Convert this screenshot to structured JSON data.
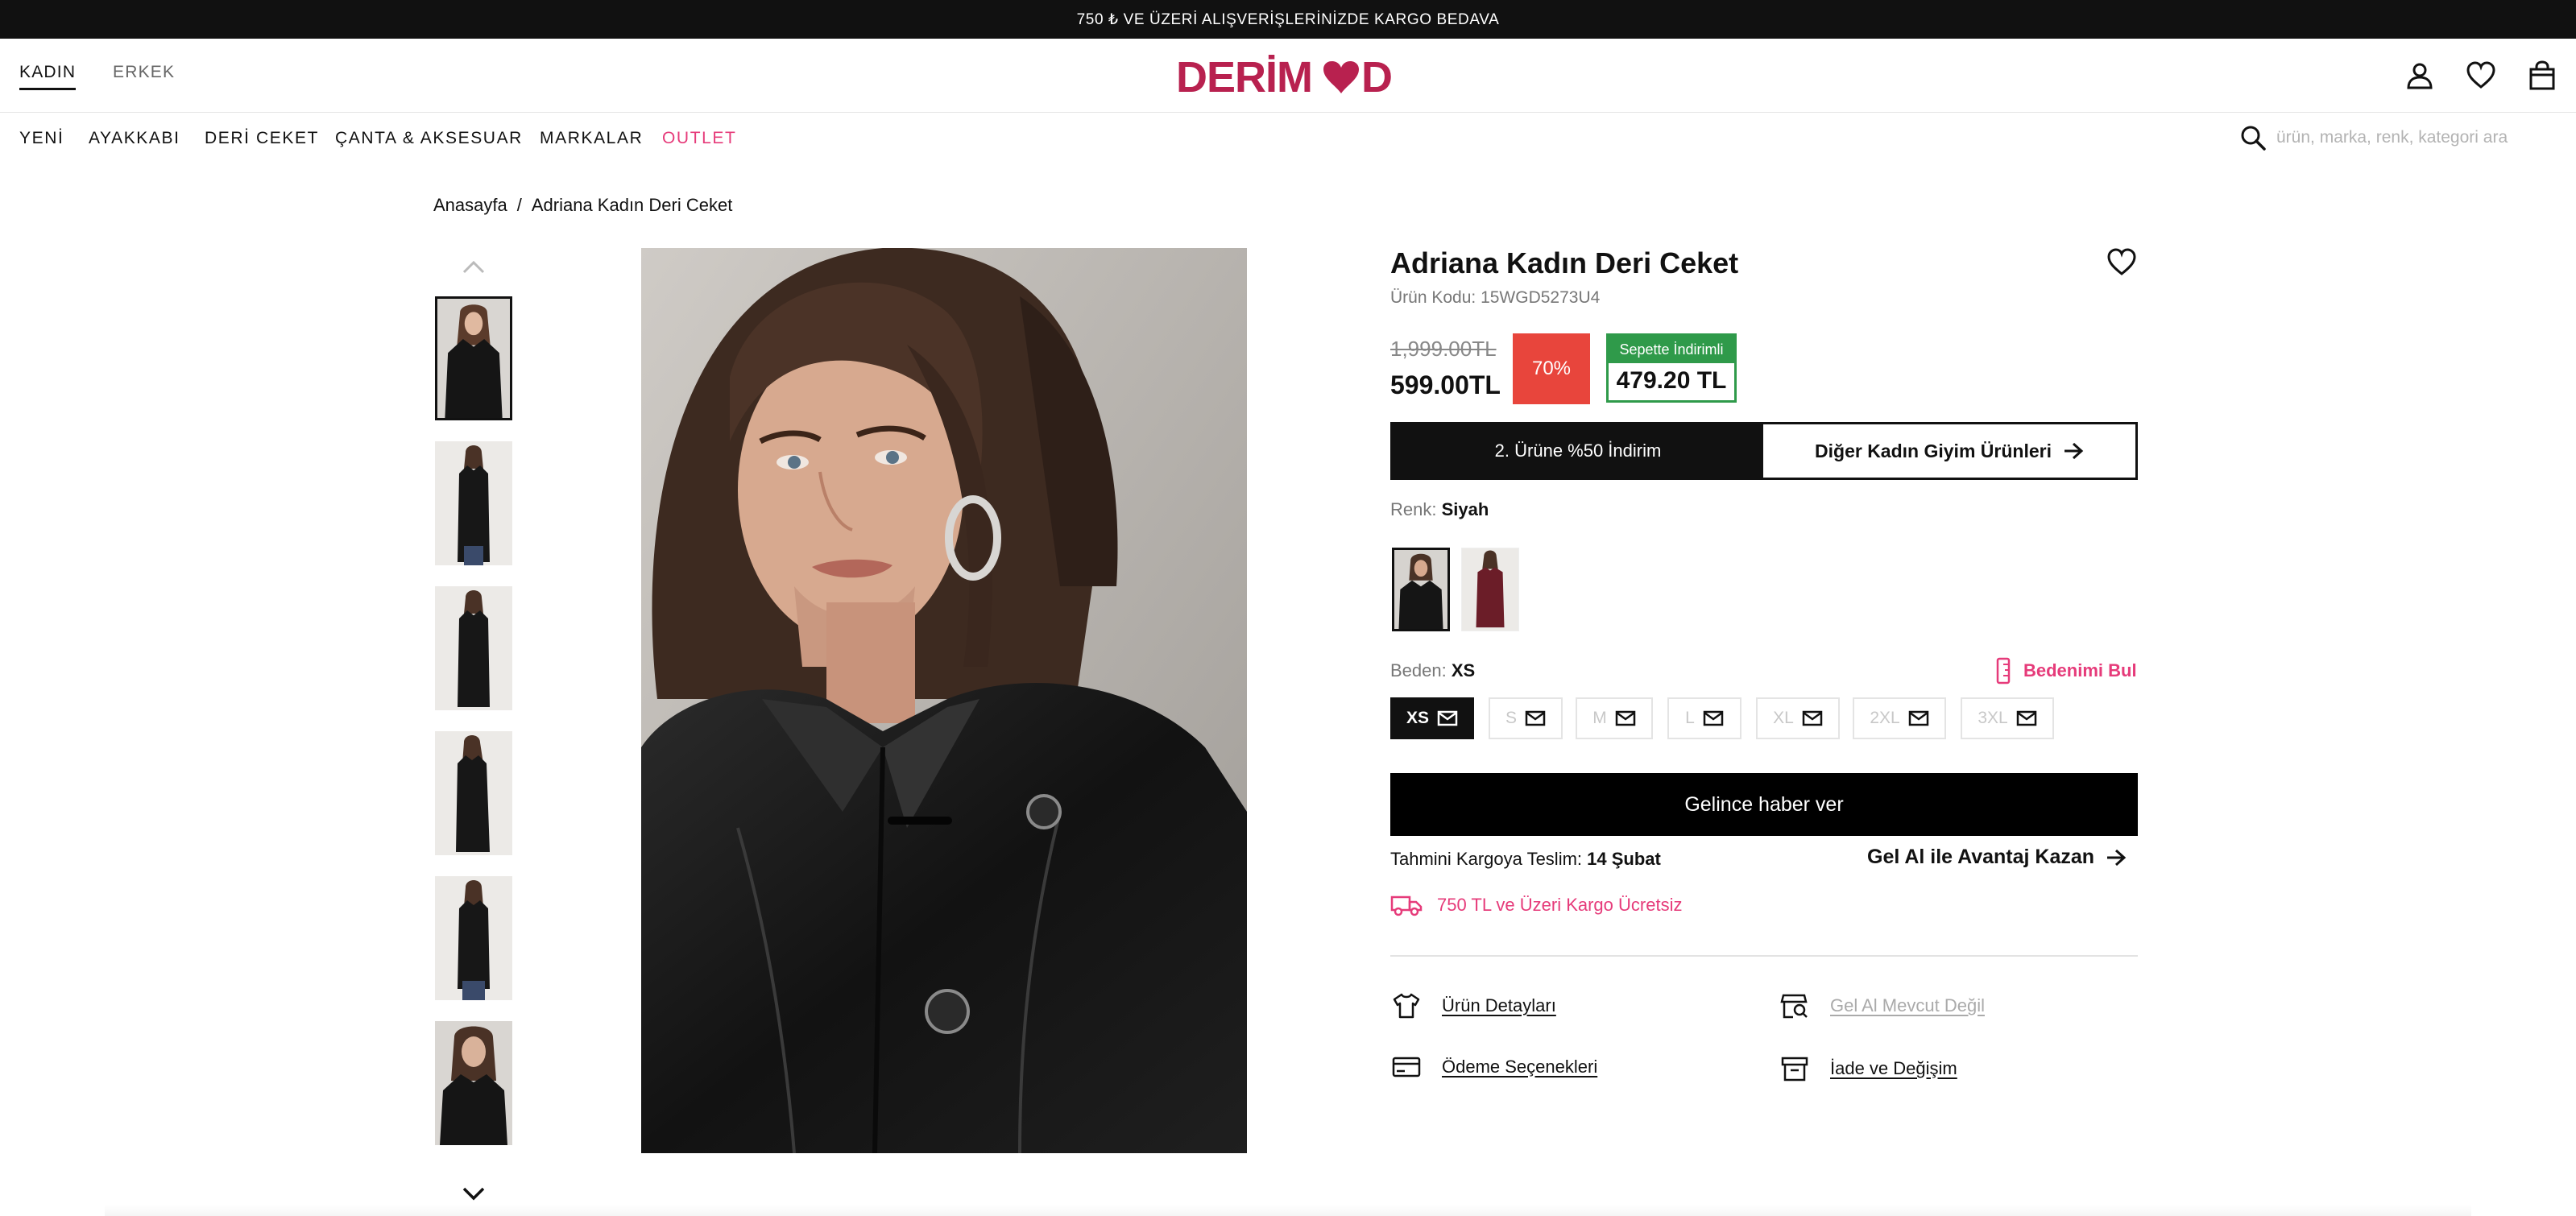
{
  "announcement": "750 ₺ VE ÜZERİ ALIŞVERİŞLERİNİZDE KARGO BEDAVA",
  "header": {
    "gender_tabs": [
      "KADIN",
      "ERKEK"
    ],
    "logo_text": "DERIMOD",
    "icons": [
      "user-icon",
      "heart-icon",
      "bag-icon"
    ]
  },
  "nav": {
    "items": [
      "YENİ",
      "AYAKKABI",
      "DERİ CEKET",
      "ÇANTA & AKSESUAR",
      "MARKALAR",
      "OUTLET"
    ],
    "search_placeholder": "ürün, marka, renk, kategori ara"
  },
  "breadcrumb": {
    "home": "Anasayfa",
    "separator": "/",
    "current": "Adriana Kadın Deri Ceket"
  },
  "product": {
    "title": "Adriana Kadın Deri Ceket",
    "code": "Ürün Kodu: 15WGD5273U4",
    "old_price": "1,999.00TL",
    "price": "599.00TL",
    "discount": "70%",
    "basket_label": "Sepette İndirimli",
    "basket_price": "479.20 TL",
    "promo_left": "2. Ürüne %50 İndirim",
    "promo_right": "Diğer Kadın Giyim Ürünleri",
    "color_label": "Renk:",
    "color_value": "Siyah",
    "size_label": "Beden:",
    "size_value": "XS",
    "find_size": "Bedenimi Bul",
    "sizes": [
      "XS",
      "S",
      "M",
      "L",
      "XL",
      "2XL",
      "3XL"
    ],
    "notify_button": "Gelince haber ver",
    "delivery_label": "Tahmini Kargoya Teslim:",
    "delivery_date": "14 Şubat",
    "gelal": "Gel Al ile Avantaj Kazan",
    "cargo_note": "750 TL ve Üzeri Kargo Ücretsiz",
    "links": {
      "details": "Ürün Detayları",
      "gelal_status": "Gel Al Mevcut Değil",
      "payment": "Ödeme Seçenekleri",
      "returns": "İade ve Değişim"
    }
  },
  "colors": {
    "accent_pink": "#e63b7a",
    "brand_logo": "#b8214f",
    "discount_red": "#e8453c",
    "basket_green": "#2f9a4a"
  }
}
